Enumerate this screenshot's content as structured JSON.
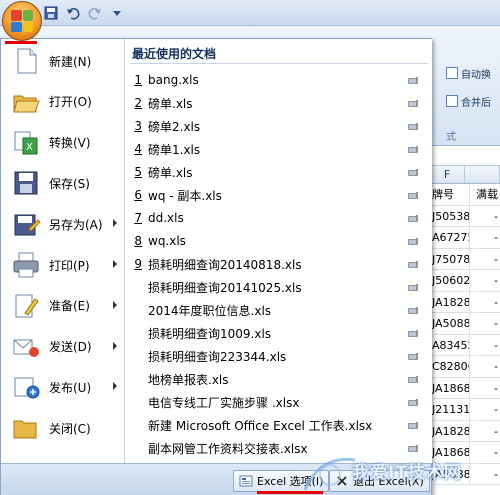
{
  "colors": {
    "office_orange": "#f39b2a",
    "accent_red": "#e30000",
    "menu_border": "#8aa6cc"
  },
  "qat": {
    "icons": [
      "save-icon",
      "undo-icon",
      "redo-icon",
      "customize-icon"
    ]
  },
  "ribbon": {
    "auto_wrap_label": "自动换",
    "merge_label": "合并后",
    "group_label": "式"
  },
  "sheet": {
    "columns": [
      "F",
      ""
    ],
    "headers": [
      "牌号",
      "满载"
    ],
    "rows": [
      [
        "J50538",
        "-"
      ],
      [
        "A67275",
        "-"
      ],
      [
        "J75078",
        "-"
      ],
      [
        "J50602",
        "-"
      ],
      [
        "JA1828",
        "-"
      ],
      [
        "JA5088",
        "-"
      ],
      [
        "A83452",
        "-"
      ],
      [
        "C82806",
        "-"
      ],
      [
        "JA1868",
        "-"
      ],
      [
        "J21131",
        "-"
      ],
      [
        "JA1828",
        "-"
      ],
      [
        "JA1868",
        "-"
      ],
      [
        "JA5088",
        "-"
      ]
    ]
  },
  "menu": {
    "items": [
      {
        "label": "新建(N)",
        "icon": "new-document-icon",
        "has_submenu": false
      },
      {
        "label": "打开(O)",
        "icon": "open-folder-icon",
        "has_submenu": false
      },
      {
        "label": "转换(V)",
        "icon": "convert-icon",
        "has_submenu": false
      },
      {
        "label": "保存(S)",
        "icon": "save-disk-icon",
        "has_submenu": false
      },
      {
        "label": "另存为(A)",
        "icon": "save-as-icon",
        "has_submenu": true
      },
      {
        "label": "打印(P)",
        "icon": "printer-icon",
        "has_submenu": true
      },
      {
        "label": "准备(E)",
        "icon": "prepare-icon",
        "has_submenu": true
      },
      {
        "label": "发送(D)",
        "icon": "send-icon",
        "has_submenu": true
      },
      {
        "label": "发布(U)",
        "icon": "publish-icon",
        "has_submenu": true
      },
      {
        "label": "关闭(C)",
        "icon": "close-folder-icon",
        "has_submenu": false
      }
    ],
    "recent_title": "最近使用的文档",
    "recent": [
      {
        "num": "1",
        "name": "bang.xls"
      },
      {
        "num": "2",
        "name": "磅单.xls"
      },
      {
        "num": "3",
        "name": "磅单2.xls"
      },
      {
        "num": "4",
        "name": "磅单1.xls"
      },
      {
        "num": "5",
        "name": "磅单.xls"
      },
      {
        "num": "6",
        "name": "wq - 副本.xls"
      },
      {
        "num": "7",
        "name": "dd.xls"
      },
      {
        "num": "8",
        "name": "wq.xls"
      },
      {
        "num": "9",
        "name": "损耗明细查询20140818.xls"
      },
      {
        "num": "",
        "name": "损耗明细查询20141025.xls"
      },
      {
        "num": "",
        "name": "2014年度职位信息.xls"
      },
      {
        "num": "",
        "name": "损耗明细查询1009.xls"
      },
      {
        "num": "",
        "name": "损耗明细查询223344.xls"
      },
      {
        "num": "",
        "name": "地榜单报表.xls"
      },
      {
        "num": "",
        "name": "电信专线工厂实施步骤 .xlsx"
      },
      {
        "num": "",
        "name": "新建 Microsoft Office Excel 工作表.xlsx"
      },
      {
        "num": "",
        "name": "副本网管工作资料交接表.xlsx"
      }
    ],
    "excel_options_label": "Excel 选项(I)",
    "exit_label": "退出 Excel(X)"
  },
  "watermark": {
    "text": "我爱IT技术网"
  }
}
